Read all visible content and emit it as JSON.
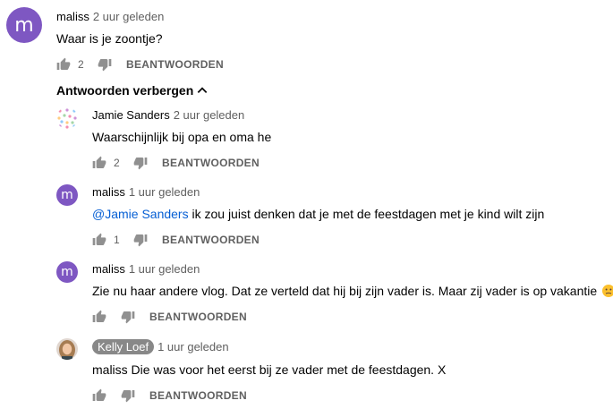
{
  "top_comment": {
    "avatar_letter": "m",
    "author": "maliss",
    "time": "2 uur geleden",
    "text": "Waar is je zoontje?",
    "likes": "2",
    "reply_label": "BEANTWOORDEN"
  },
  "replies_toggle": {
    "label": "Antwoorden verbergen"
  },
  "replies": [
    {
      "author": "Jamie Sanders",
      "time": "2 uur geleden",
      "text": "Waarschijnlijk bij opa en oma he",
      "likes": "2",
      "reply_label": "BEANTWOORDEN"
    },
    {
      "avatar_letter": "m",
      "author": "maliss",
      "time": "1 uur geleden",
      "mention": "@Jamie Sanders",
      "text": " ik zou juist denken dat je met de feestdagen met je kind wilt zijn",
      "likes": "1",
      "reply_label": "BEANTWOORDEN"
    },
    {
      "avatar_letter": "m",
      "author": "maliss",
      "time": "1 uur geleden",
      "text": "Zie nu haar andere vlog. Dat ze verteld dat hij bij zijn vader is. Maar zij vader is op vakantie ",
      "likes": "",
      "reply_label": "BEANTWOORDEN"
    },
    {
      "author": "Kelly Loef",
      "time": "1 uur geleden",
      "text": "maliss Die was voor het eerst bij ze vader met de feestdagen. X",
      "likes": "",
      "reply_label": "BEANTWOORDEN"
    }
  ],
  "colors": {
    "avatar_purple": "#7e57c2",
    "mention_blue": "#065fd4",
    "secondary_text": "#606060",
    "author_chip_bg": "#888888"
  },
  "icons": [
    "thumb-up-icon",
    "thumb-down-icon",
    "chevron-up-icon",
    "face-emoji-icon"
  ]
}
